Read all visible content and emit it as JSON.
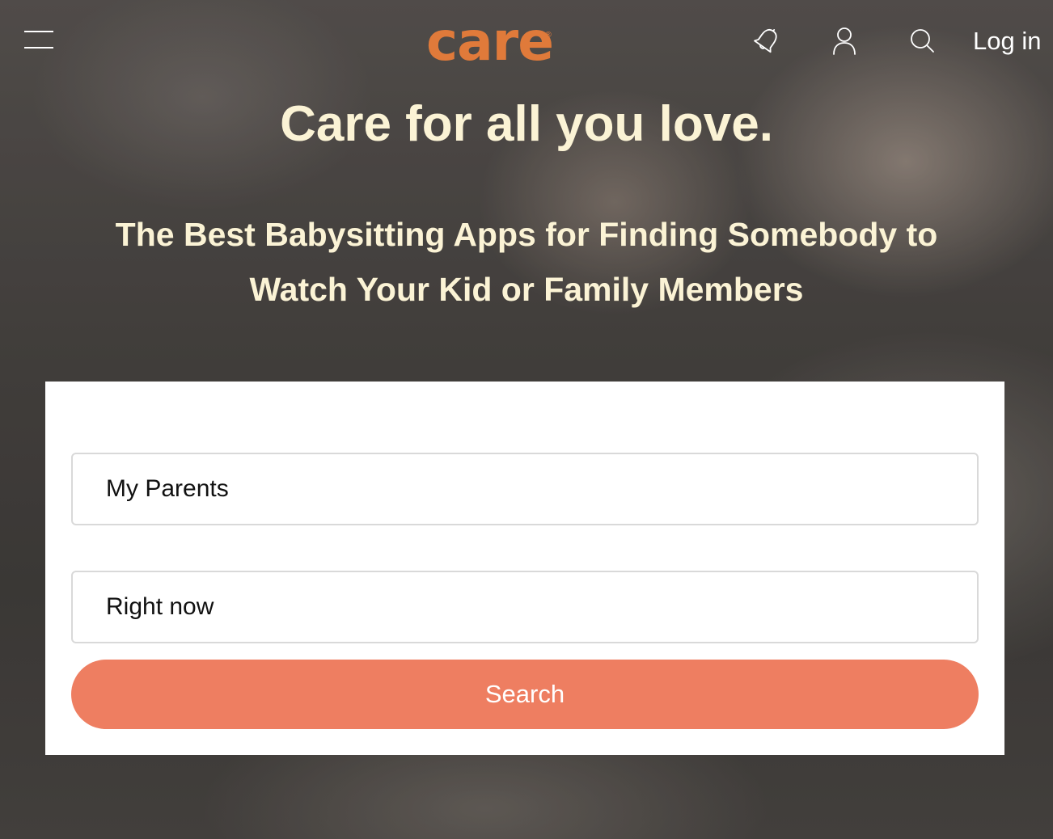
{
  "header": {
    "menu_icon": "hamburger-menu-icon",
    "logo_text": "care",
    "logo_mark": "®",
    "icons": [
      "bell-icon",
      "user-icon",
      "search-icon"
    ],
    "login_label": "Log in"
  },
  "hero": {
    "tagline": "Care for all you love.",
    "article_title": "The Best Babysitting Apps for Finding Somebody to Watch Your Kid or Family Members"
  },
  "search_form": {
    "care_for_value": "My Parents",
    "when_value": "Right now",
    "submit_label": "Search"
  },
  "colors": {
    "brand_orange": "#e07a3a",
    "button": "#ee7e61",
    "headline": "#fbf3d5"
  }
}
